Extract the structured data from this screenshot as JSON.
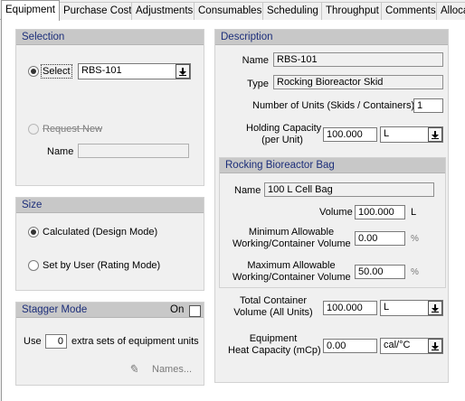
{
  "tabs": [
    "Equipment",
    "Purchase Cost",
    "Adjustments",
    "Consumables",
    "Scheduling",
    "Throughput",
    "Comments",
    "Alloca"
  ],
  "selection": {
    "title": "Selection",
    "select_label": "Select",
    "select_value": "RBS-101",
    "request_new_label": "Request New",
    "name_label": "Name",
    "name_value": ""
  },
  "size": {
    "title": "Size",
    "calculated_label": "Calculated (Design Mode)",
    "set_by_user_label": "Set by User (Rating Mode)"
  },
  "stagger": {
    "title": "Stagger Mode",
    "on_label": "On",
    "use_label": "Use",
    "extra_sets_value": "0",
    "extra_sets_label": "extra sets of equipment units",
    "names_button": "Names..."
  },
  "description": {
    "title": "Description",
    "name_label": "Name",
    "name_value": "RBS-101",
    "type_label": "Type",
    "type_value": "Rocking Bioreactor Skid",
    "units_label": "Number of Units (Skids / Containers)",
    "units_value": "1",
    "holding_line1": "Holding Capacity",
    "holding_line2": "(per Unit)",
    "holding_value": "100.000",
    "holding_unit": "L"
  },
  "bag": {
    "title": "Rocking Bioreactor Bag",
    "name_label": "Name",
    "name_value": "100 L  Cell Bag",
    "volume_label": "Volume",
    "volume_value": "100.000",
    "volume_unit": "L",
    "min_line1": "Minimum Allowable",
    "min_line2": "Working/Container Volume",
    "min_value": "0.00",
    "min_unit": "%",
    "max_line1": "Maximum Allowable",
    "max_line2": "Working/Container Volume",
    "max_value": "50.00",
    "max_unit": "%"
  },
  "totals": {
    "total_line1": "Total Container",
    "total_line2": "Volume (All Units)",
    "total_value": "100.000",
    "total_unit": "L",
    "heat_line1": "Equipment",
    "heat_line2": "Heat Capacity (mCp)",
    "heat_value": "0.00",
    "heat_unit": "cal/°C"
  }
}
